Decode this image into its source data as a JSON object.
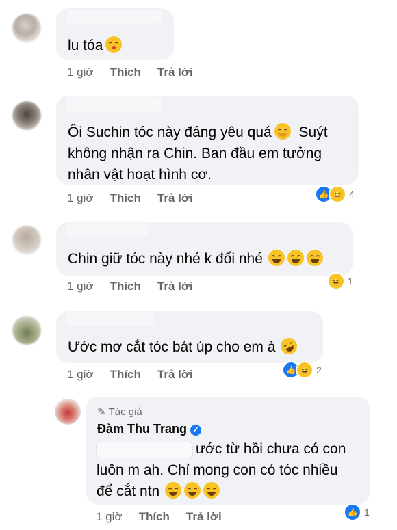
{
  "comments": [
    {
      "text_lines": [
        "lu tóa"
      ],
      "emoji": [
        "face-blowing-kiss"
      ],
      "time": "1 giờ",
      "like": "Thích",
      "reply": "Trả lời",
      "reactions": null
    },
    {
      "text_lines": [
        "Ôi Suchin tóc này đáng yêu quá",
        "Suýt",
        "không nhận ra Chin. Ban đầu em tưởng",
        "nhân vật hoạt hình cơ."
      ],
      "emoji": [
        "hugging-face"
      ],
      "time": "1 giờ",
      "like": "Thích",
      "reply": "Trả lời",
      "reactions": {
        "types": [
          "like",
          "haha"
        ],
        "count": "4"
      }
    },
    {
      "text_lines": [
        "Chin giữ tóc này nhé k đổi nhé"
      ],
      "emoji": [
        "grinning-squinting-face",
        "grinning-squinting-face",
        "grinning-squinting-face"
      ],
      "time": "1 giờ",
      "like": "Thích",
      "reply": "Trả lời",
      "reactions": {
        "types": [
          "haha"
        ],
        "count": "1"
      }
    },
    {
      "text_lines": [
        "Ước mơ cắt tóc bát úp cho em à"
      ],
      "emoji": [
        "rolling-laughing-face"
      ],
      "time": "1 giờ",
      "like": "Thích",
      "reply": "Trả lời",
      "reactions": {
        "types": [
          "like",
          "haha"
        ],
        "count": "2"
      }
    }
  ],
  "reply": {
    "author_tag": "Tác giả",
    "author_name": "Đàm Thu Trang",
    "text_lines": [
      "ước từ hồi chưa có con",
      "luôn m ah. Chỉ mong con có tóc nhiều",
      "để cắt ntn"
    ],
    "emoji": [
      "tears-of-joy",
      "tears-of-joy",
      "tears-of-joy"
    ],
    "time": "1 giờ",
    "like": "Thích",
    "reply": "Trả lời",
    "reactions": {
      "types": [
        "like"
      ],
      "count": "1"
    }
  },
  "icons": {
    "pencil": "✎",
    "check": "✓",
    "like": "👍",
    "haha": "😆"
  },
  "colors": {
    "bubble": "#f0f2f5",
    "meta": "#65676b",
    "like_blue": "#1877f2",
    "emoji_yellow": "#f7c326"
  }
}
